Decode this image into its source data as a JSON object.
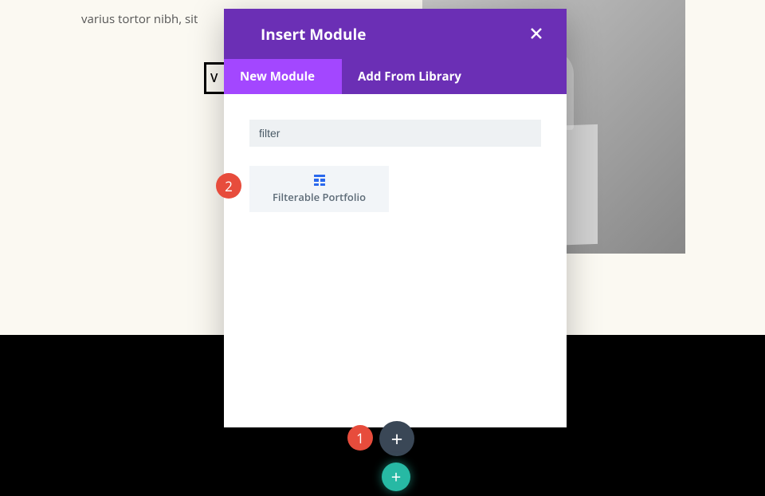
{
  "background": {
    "text_fragment": "varius tortor nibh, sit",
    "button_fragment": "V"
  },
  "modal": {
    "title": "Insert Module",
    "tabs": {
      "new_module": "New Module",
      "add_from_library": "Add From Library"
    },
    "search_value": "filter",
    "results": {
      "0": {
        "label": "Filterable Portfolio"
      }
    }
  },
  "annotations": {
    "1": "1",
    "2": "2"
  }
}
